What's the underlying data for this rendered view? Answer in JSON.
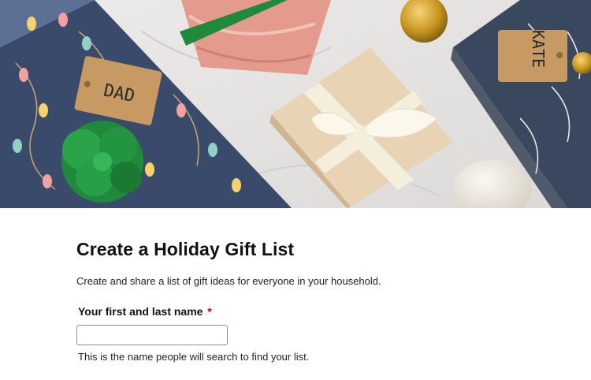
{
  "hero": {
    "tag_dad": "DAD",
    "tag_kate": "KATE"
  },
  "form": {
    "title": "Create a Holiday Gift List",
    "subtitle": "Create and share a list of gift ideas for everyone in your household.",
    "name_label": "Your first and last name",
    "required_marker": "*",
    "name_value": "",
    "name_hint": "This is the name people will search to find your list."
  },
  "colors": {
    "required": "#c40000",
    "navy_paper": "#3a4a6b",
    "green_ribbon": "#1f8a3c",
    "kraft": "#e8d3b4",
    "gold": "#c8961e"
  }
}
